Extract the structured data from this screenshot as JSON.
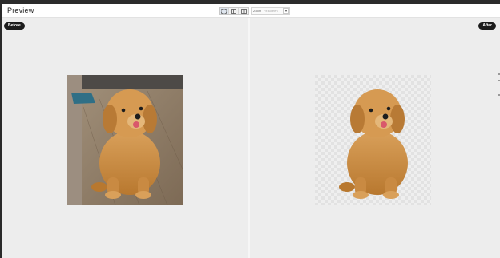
{
  "header": {
    "title": "Preview",
    "zoom_label": "Zoom",
    "zoom_value": "Fit screen"
  },
  "panes": {
    "before_label": "Before",
    "after_label": "After"
  },
  "icons": {
    "view_fit": "fit-view-icon",
    "view_split": "split-view-icon",
    "view_side": "side-by-side-icon",
    "zoom_dropdown": "chevron-down-icon"
  },
  "colors": {
    "badge": "#1c1c1c",
    "pane_bg": "#ededed",
    "fur": "#c9893f"
  }
}
